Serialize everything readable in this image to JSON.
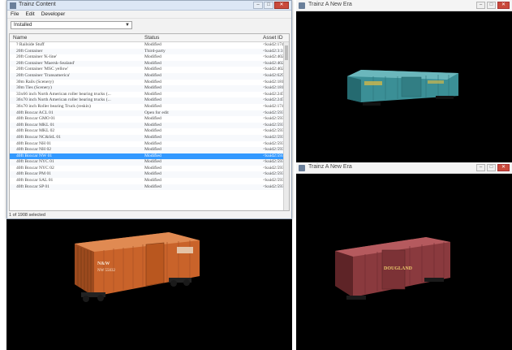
{
  "content_window": {
    "title": "Trainz Content",
    "menu": [
      "File",
      "Edit",
      "Developer"
    ],
    "filter": "Installed",
    "columns": [
      "Name",
      "Status",
      "Asset ID"
    ],
    "rows": [
      {
        "name": "? Railside Stuff",
        "status": "Modified",
        "id": "<kuid2:174"
      },
      {
        "name": "20ft Container",
        "status": "Third-party",
        "id": "<kuid2:3:31"
      },
      {
        "name": "20ft Container 'K-line'",
        "status": "Modified",
        "id": "<kuid2:402"
      },
      {
        "name": "20ft Container 'Maersk-Sealand'",
        "status": "Modified",
        "id": "<kuid2:402"
      },
      {
        "name": "20ft Container 'MSC yellow'",
        "status": "Modified",
        "id": "<kuid2:402"
      },
      {
        "name": "20ft Container 'Transamerica'",
        "status": "Modified",
        "id": "<kuid2:629"
      },
      {
        "name": "30m Rails (Scenery)",
        "status": "Modified",
        "id": "<kuid2:1816"
      },
      {
        "name": "30m Ties (Scenery)",
        "status": "Modified",
        "id": "<kuid2:1816"
      },
      {
        "name": "33x66 inch North American roller bearing trucks (...",
        "status": "Modified",
        "id": "<kuid2:2456"
      },
      {
        "name": "36x70 inch North American roller bearing trucks (...",
        "status": "Modified",
        "id": "<kuid2:2456"
      },
      {
        "name": "36x70 inch Roller bearing Truck (reskin)",
        "status": "Modified",
        "id": "<kuid2:174"
      },
      {
        "name": "40ft Boxcar ACL 01",
        "status": "Open for edit",
        "id": "<kuid2:593"
      },
      {
        "name": "40ft Boxcar GMO 01",
        "status": "Modified",
        "id": "<kuid2:593"
      },
      {
        "name": "40ft Boxcar MKL 01",
        "status": "Modified",
        "id": "<kuid2:593"
      },
      {
        "name": "40ft Boxcar MKL 02",
        "status": "Modified",
        "id": "<kuid2:593"
      },
      {
        "name": "40ft Boxcar NC&StL 01",
        "status": "Modified",
        "id": "<kuid2:593"
      },
      {
        "name": "40ft Boxcar NH 01",
        "status": "Modified",
        "id": "<kuid2:593"
      },
      {
        "name": "40ft Boxcar NH 02",
        "status": "Modified",
        "id": "<kuid2:593"
      },
      {
        "name": "40ft Boxcar NW 01",
        "status": "Modified",
        "id": "<kuid2:593",
        "selected": true
      },
      {
        "name": "40ft Boxcar NYC 01",
        "status": "Modified",
        "id": "<kuid2:593"
      },
      {
        "name": "40ft Boxcar NYC 02",
        "status": "Modified",
        "id": "<kuid2:593"
      },
      {
        "name": "40ft Boxcar PM 01",
        "status": "Modified",
        "id": "<kuid2:593"
      },
      {
        "name": "40ft Boxcar SAL 01",
        "status": "Modified",
        "id": "<kuid2:593"
      },
      {
        "name": "40ft Boxcar SP 01",
        "status": "Modified",
        "id": "<kuid2:593"
      }
    ],
    "status_text": "1 of 1908 selected"
  },
  "preview_top_right": {
    "title": "Trainz A New Era"
  },
  "preview_bottom_right": {
    "title": "Trainz A New Era"
  },
  "car_markings": {
    "bottom_left": [
      "N&W",
      "NW 55032"
    ],
    "bottom_right": "DOUGLAND"
  },
  "colors": {
    "selection": "#3399ff",
    "viewport_bg": "#000000",
    "boxcar_green": "#3b8f96",
    "boxcar_orange": "#c9632a",
    "boxcar_red": "#8a3a3e"
  }
}
